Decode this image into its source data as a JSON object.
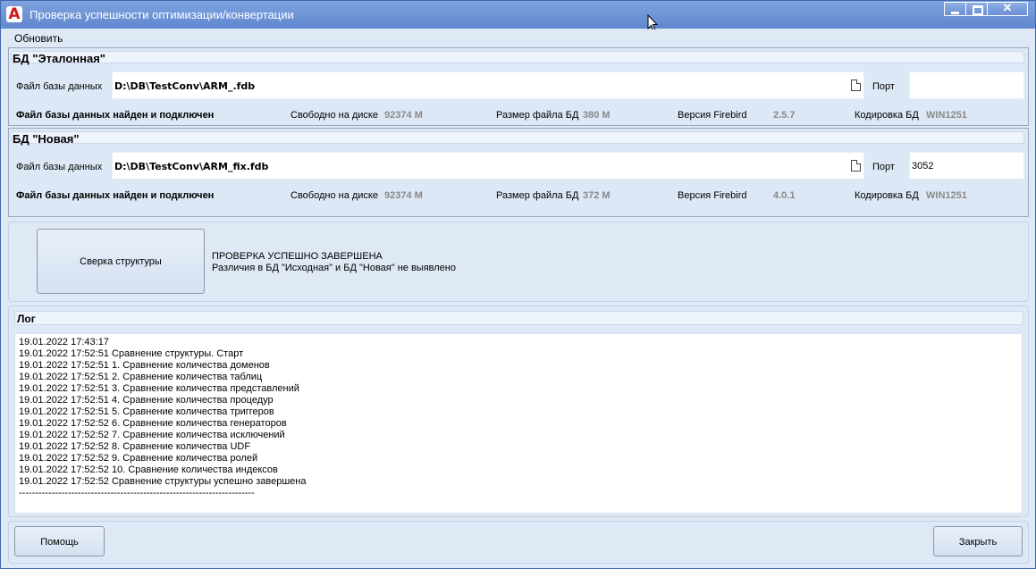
{
  "window": {
    "title": "Проверка успешности оптимизации/конвертации",
    "icon": "app-logo-a"
  },
  "menu": {
    "refresh": "Обновить"
  },
  "db_ref": {
    "title": "БД \"Эталонная\"",
    "file_label": "Файл базы данных",
    "file_path": "D:\\DB\\TestConv\\ARM_.fdb",
    "port_label": "Порт",
    "port_value": "",
    "status": "Файл базы данных найден и подключен",
    "free_label": "Свободно на диске",
    "free_value": "92374 М",
    "size_label": "Размер файла  БД",
    "size_value": "380 М",
    "fb_label": "Версия Firebird",
    "fb_value": "2.5.7",
    "enc_label": "Кодировка БД",
    "enc_value": "WIN1251"
  },
  "db_new": {
    "title": "БД \"Новая\"",
    "file_label": "Файл базы данных",
    "file_path": "D:\\DB\\TestConv\\ARM_fix.fdb",
    "port_label": "Порт",
    "port_value": "3052",
    "status": "Файл базы данных найден и подключен",
    "free_label": "Свободно на диске",
    "free_value": "92374 М",
    "size_label": "Размер файла  БД",
    "size_value": "372 М",
    "fb_label": "Версия Firebird",
    "fb_value": "4.0.1",
    "enc_label": "Кодировка БД",
    "enc_value": "WIN1251"
  },
  "check": {
    "button": "Сверка структуры",
    "result_line1": "ПРОВЕРКА УСПЕШНО ЗАВЕРШЕНА",
    "result_line2": "Различия в БД \"Исходная\" и БД \"Новая\" не выявлено"
  },
  "log": {
    "title": "Лог",
    "lines": [
      "19.01.2022 17:43:17",
      "19.01.2022 17:52:51 Сравнение структуры. Старт",
      "19.01.2022 17:52:51 1. Сравнение количества доменов",
      "19.01.2022 17:52:51 2. Сравнение количества таблиц",
      "19.01.2022 17:52:51 3. Сравнение количества представлений",
      "19.01.2022 17:52:51 4. Сравнение количества процедур",
      "19.01.2022 17:52:51 5. Сравнение количества триггеров",
      "19.01.2022 17:52:52 6. Сравнение количества генераторов",
      "19.01.2022 17:52:52 7. Сравнение количества исключений",
      "19.01.2022 17:52:52 8. Сравнение количества UDF",
      "19.01.2022 17:52:52 9. Сравнение количества ролей",
      "19.01.2022 17:52:52 10. Сравнение количества индексов",
      "19.01.2022 17:52:52 Сравнение структуры успешно завершена",
      "------------------------------------------------------------------------"
    ]
  },
  "footer": {
    "help": "Помощь",
    "close": "Закрыть"
  }
}
